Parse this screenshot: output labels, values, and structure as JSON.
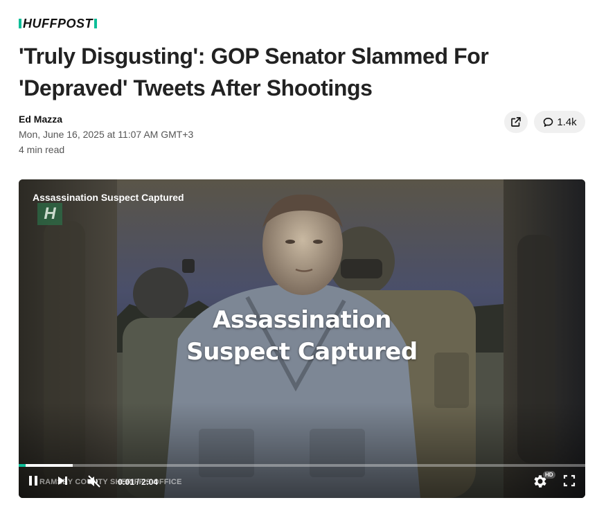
{
  "brand": {
    "logo_text": "HUFFPOST",
    "accent_color": "#0dbe98"
  },
  "article": {
    "headline": "'Truly Disgusting': GOP Senator Slammed For 'Depraved' Tweets After Shootings",
    "author": "Ed Mazza",
    "date": "Mon, June 16, 2025 at 11:07 AM GMT+3",
    "read_time": "4 min read"
  },
  "actions": {
    "share_icon": "share-external-icon",
    "comment_icon": "comment-bubble-icon",
    "comment_count": "1.4k"
  },
  "video": {
    "title": "Assassination Suspect Captured",
    "channel_badge": "H",
    "overlay_text": "Assassination Suspect Captured",
    "credit": "RAMSEY COUNTY SHERIFF'S OFFICE",
    "current_time": "0:01",
    "duration": "2:04",
    "time_separator": "/",
    "progress_fraction": 0.095,
    "quality_badge": "HD",
    "icons": {
      "pause": "pause-icon",
      "next": "next-icon",
      "mute": "muted-volume-icon",
      "settings": "gear-icon",
      "fullscreen": "fullscreen-icon"
    }
  }
}
